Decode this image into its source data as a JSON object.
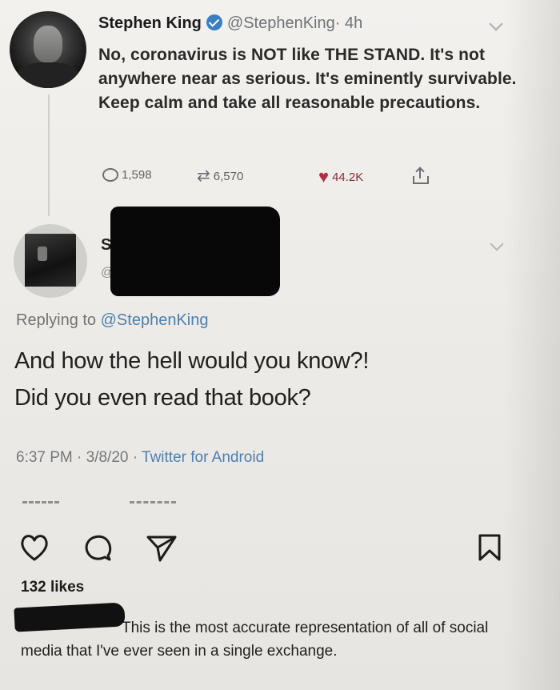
{
  "tweet1": {
    "name": "Stephen King",
    "handle": "@StephenKing",
    "time": "· 4h",
    "text": "No, coronavirus is NOT like THE STAND. It's not anywhere near as serious. It's eminently survivable. Keep calm and take all reasonable precautions.",
    "replies": "1,598",
    "retweets": "6,570",
    "likes": "44.2K",
    "icons": [
      "reply-icon",
      "retweet-icon",
      "heart-icon",
      "share-icon",
      "verified-badge-icon",
      "chevron-down-icon"
    ],
    "like_color": "#b03042"
  },
  "tweet2": {
    "name_visible": "S",
    "handle_visible": "@",
    "replying_prefix": "Replying to",
    "replying_to": "@StephenKing",
    "text_line1": "And how the hell would you know?!",
    "text_line2": "Did you even read that book?",
    "timestamp": "6:37 PM · 3/8/20 ·",
    "client": "Twitter for Android",
    "accent": "#4d7fb0"
  },
  "instagram": {
    "likes": "132 likes",
    "caption": "This is the most accurate representation of all of social media that I've ever seen in a single exchange.",
    "icons": [
      "heart-icon",
      "comment-icon",
      "send-icon",
      "bookmark-icon"
    ]
  }
}
